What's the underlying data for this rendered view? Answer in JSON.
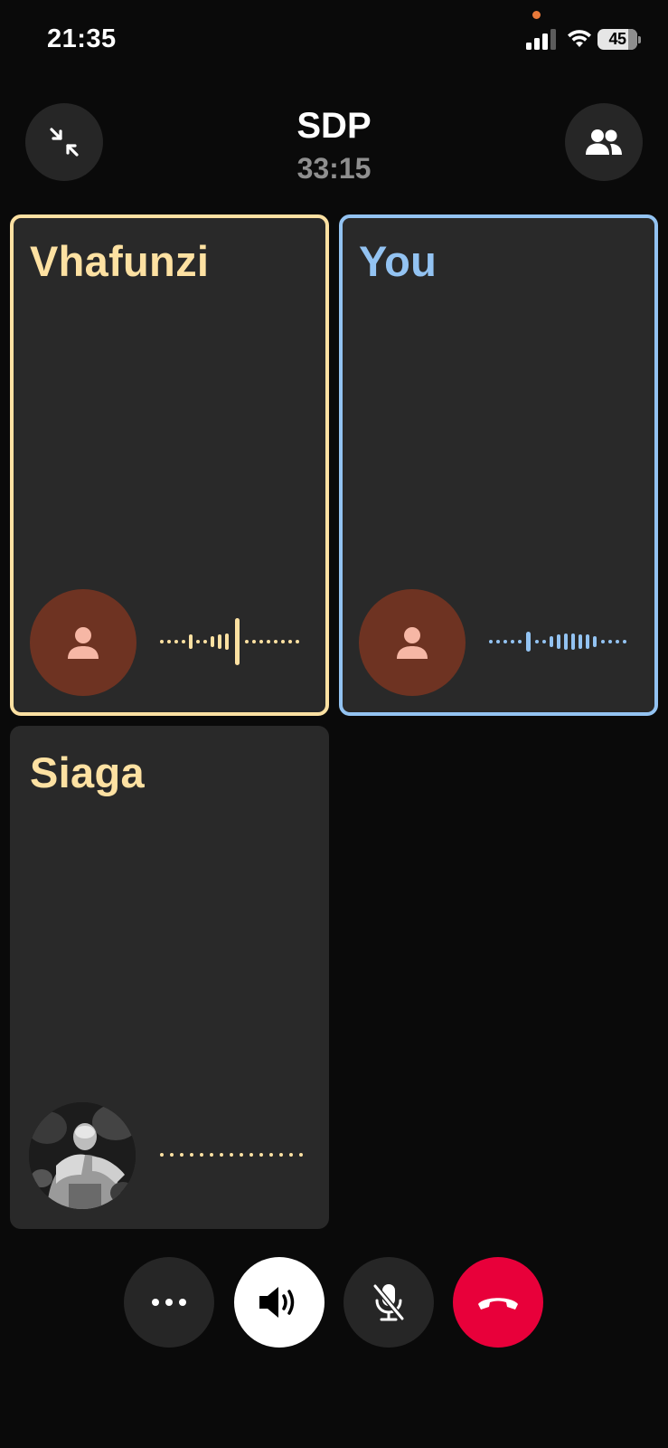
{
  "status_bar": {
    "time": "21:35",
    "battery": "45",
    "icons": [
      "cellular-signal-icon",
      "wifi-icon",
      "battery-icon"
    ],
    "privacy_indicator_color": "#e8793a"
  },
  "header": {
    "title": "SDP",
    "timer": "33:15",
    "left_button_icon": "minimize-arrows-icon",
    "right_button_icon": "participants-icon"
  },
  "participants": [
    {
      "name": "Vhafunzi",
      "border_color": "#fde1a2",
      "name_color": "#fde1a2",
      "avatar": "person-icon",
      "speaking": true
    },
    {
      "name": "You",
      "border_color": "#93c3f2",
      "name_color": "#93c3f2",
      "avatar": "person-icon",
      "speaking": true
    },
    {
      "name": "Siaga",
      "border_color": null,
      "name_color": "#fde1a2",
      "avatar": "photo",
      "speaking": false
    }
  ],
  "controls": [
    {
      "name": "more",
      "icon": "more-dots-icon",
      "bg": "#262626"
    },
    {
      "name": "speaker",
      "icon": "speaker-icon",
      "bg": "#ffffff"
    },
    {
      "name": "mute",
      "icon": "mic-off-icon",
      "bg": "#262626"
    },
    {
      "name": "end-call",
      "icon": "hang-up-icon",
      "bg": "#e8003a"
    }
  ]
}
